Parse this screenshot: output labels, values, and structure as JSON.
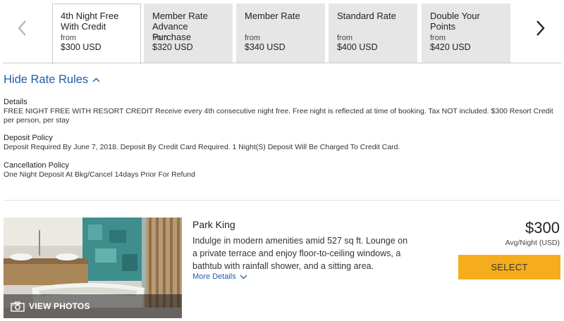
{
  "rates": [
    {
      "name_line1": "4th Night Free",
      "name_line2": "With Credit",
      "from": "from",
      "price": "$300 USD",
      "active": true
    },
    {
      "name_line1": "Member Rate",
      "name_line2": "Advance Purchase",
      "from": "from",
      "price": "$320 USD",
      "active": false
    },
    {
      "name_line1": "Member Rate",
      "name_line2": "",
      "from": "from",
      "price": "$340 USD",
      "active": false
    },
    {
      "name_line1": "Standard Rate",
      "name_line2": "",
      "from": "from",
      "price": "$400 USD",
      "active": false
    },
    {
      "name_line1": "Double Your",
      "name_line2": "Points",
      "from": "from",
      "price": "$420 USD",
      "active": false
    }
  ],
  "rate_rules": {
    "toggle_label": "Hide Rate Rules",
    "details_title": "Details",
    "details_text": "FREE NIGHT FREE WITH RESORT CREDIT Receive every 4th consecutive night free. Free night is reflected at time of booking. Tax NOT included. $300 Resort Credit per person, per stay",
    "deposit_title": "Deposit Policy",
    "deposit_text": "Deposit Required By June 7, 2018. Deposit By Credit Card Required. 1 Night(S) Deposit Will Be Charged To Credit Card.",
    "cancel_title": "Cancellation Policy",
    "cancel_text": "One Night Deposit At Bkg/Cancel 14days Prior For Refund"
  },
  "room": {
    "photo_label": "VIEW PHOTOS",
    "name": "Park King",
    "description": "Indulge in modern amenities amid 527 sq ft. Lounge on a private terrace and enjoy floor-to-ceiling windows, a bathtub with rainfall shower, and a sitting area.",
    "more_details": "More Details",
    "price": "$300",
    "price_unit": "Avg/Night (USD)",
    "select_label": "SELECT"
  },
  "icons": {
    "prev": "chevron-left-icon",
    "next": "chevron-right-icon",
    "rules_toggle": "chevron-up-icon",
    "more_details": "chevron-down-icon",
    "photos": "camera-icon"
  },
  "colors": {
    "link": "#1f5ea8",
    "select_button": "#f5ad1c",
    "tab_inactive": "#e6e6e6"
  }
}
